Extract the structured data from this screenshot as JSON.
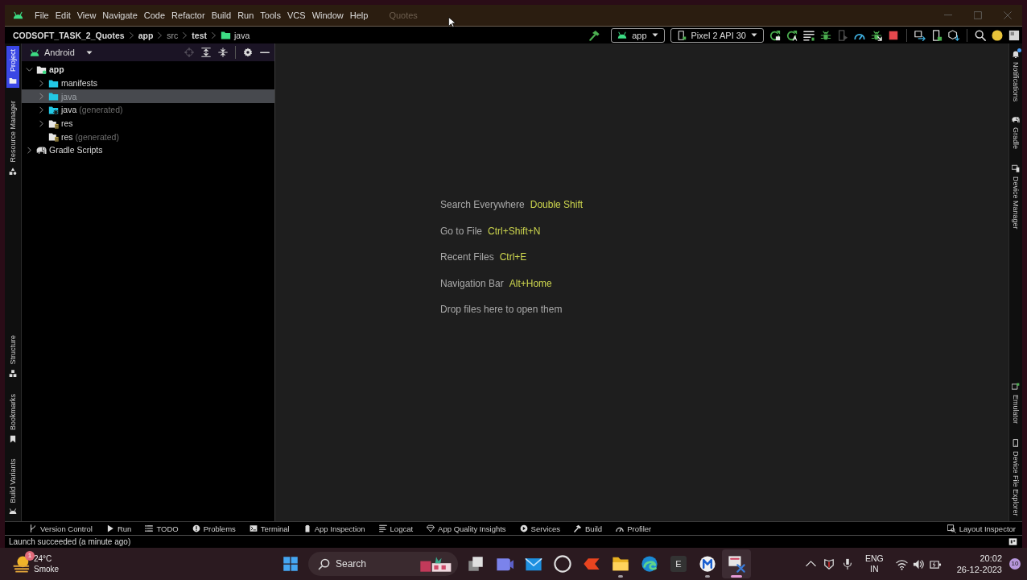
{
  "window": {
    "menu": [
      "File",
      "Edit",
      "View",
      "Navigate",
      "Code",
      "Refactor",
      "Build",
      "Run",
      "Tools",
      "VCS",
      "Window",
      "Help"
    ],
    "title": "Quotes"
  },
  "navigation_bar": {
    "breadcrumbs": [
      {
        "label": "CODSOFT_TASK_2_Quotes",
        "kind": "project"
      },
      {
        "label": "app",
        "kind": "module"
      },
      {
        "label": "src",
        "kind": "directory"
      },
      {
        "label": "test",
        "kind": "source-set"
      },
      {
        "label": "java",
        "kind": "folder"
      }
    ]
  },
  "main_toolbar": {
    "build_action": {
      "disabled": false
    },
    "run_configuration": "app",
    "device": "Pixel 2 API 30",
    "run_actions": [
      {
        "kind": "restart",
        "disabled": false
      },
      {
        "kind": "apply-code",
        "disabled": false
      },
      {
        "kind": "lines",
        "disabled": false
      },
      {
        "kind": "bug",
        "disabled": false
      },
      {
        "kind": "profile",
        "disabled": true
      },
      {
        "kind": "gauge",
        "disabled": false
      },
      {
        "kind": "attach-bug",
        "disabled": false
      },
      {
        "kind": "stop",
        "disabled": false
      }
    ],
    "tool_actions": [
      {
        "kind": "mirror"
      },
      {
        "kind": "phone"
      },
      {
        "kind": "cube"
      }
    ],
    "ide_actions": [
      {
        "kind": "search"
      },
      {
        "kind": "update"
      },
      {
        "kind": "square"
      }
    ]
  },
  "left_strip": {
    "top": [
      {
        "label": "Project",
        "kind": "folder",
        "selected": true
      },
      {
        "label": "Resource Manager",
        "kind": "shapes",
        "selected": false
      }
    ],
    "bottom": [
      {
        "label": "Structure",
        "kind": "structure",
        "selected": false
      },
      {
        "label": "Bookmarks",
        "kind": "bookmark",
        "selected": false
      },
      {
        "label": "Build Variants",
        "kind": "variants",
        "selected": false
      }
    ]
  },
  "project_panel": {
    "view": "Android",
    "header_actions": [
      {
        "kind": "locate",
        "disabled": true
      },
      {
        "kind": "expand-all",
        "disabled": false
      },
      {
        "kind": "collapse-all",
        "disabled": false
      },
      {
        "kind": "settings",
        "disabled": false
      },
      {
        "kind": "hide",
        "disabled": false
      }
    ],
    "tree": [
      {
        "label": "app",
        "kind": "module",
        "expandable": true,
        "expanded": true,
        "selected": false,
        "children": [
          {
            "label": "manifests",
            "kind": "folder",
            "expandable": true,
            "expanded": false,
            "selected": false
          },
          {
            "label": "java",
            "kind": "folder",
            "expandable": true,
            "expanded": false,
            "selected": true
          },
          {
            "label": "java",
            "note": "(generated)",
            "kind": "generated-folder",
            "expandable": true,
            "expanded": false,
            "selected": false
          },
          {
            "label": "res",
            "kind": "res-folder",
            "expandable": true,
            "expanded": false,
            "selected": false
          },
          {
            "label": "res",
            "note": "(generated)",
            "kind": "res-folder",
            "expandable": false,
            "selected": false
          }
        ]
      },
      {
        "label": "Gradle Scripts",
        "kind": "gradle",
        "expandable": true,
        "expanded": false,
        "selected": false
      }
    ]
  },
  "editor": {
    "hints": [
      {
        "action": "Search Everywhere",
        "shortcut": "Double Shift"
      },
      {
        "action": "Go to File",
        "shortcut": "Ctrl+Shift+N"
      },
      {
        "action": "Recent Files",
        "shortcut": "Ctrl+E"
      },
      {
        "action": "Navigation Bar",
        "shortcut": "Alt+Home"
      },
      {
        "action": "Drop files here to open them"
      }
    ]
  },
  "right_strip": {
    "top": [
      {
        "label": "Notifications",
        "kind": "bell",
        "unread": true
      },
      {
        "label": "Gradle",
        "kind": "elephant",
        "unread": false
      },
      {
        "label": "Device Manager",
        "kind": "devices",
        "unread": false
      }
    ],
    "bottom": [
      {
        "label": "Emulator",
        "kind": "emulator",
        "unread": false
      },
      {
        "label": "Device File Explorer",
        "kind": "phone",
        "unread": false
      }
    ]
  },
  "tool_window_bar": {
    "left": [
      {
        "label": "Version Control",
        "kind": "vcs"
      },
      {
        "label": "Run",
        "kind": "run"
      },
      {
        "label": "TODO",
        "kind": "todo"
      },
      {
        "label": "Problems",
        "kind": "problems"
      },
      {
        "label": "Terminal",
        "kind": "terminal"
      },
      {
        "label": "App Inspection",
        "kind": "inspection"
      },
      {
        "label": "Logcat",
        "kind": "logcat"
      },
      {
        "label": "App Quality Insights",
        "kind": "insights"
      },
      {
        "label": "Services",
        "kind": "services"
      },
      {
        "label": "Build",
        "kind": "build"
      },
      {
        "label": "Profiler",
        "kind": "profiler"
      }
    ],
    "right": [
      {
        "label": "Layout Inspector",
        "kind": "layout-inspector"
      }
    ]
  },
  "status_bar": {
    "message": "Launch succeeded (a minute ago)"
  },
  "taskbar": {
    "weather": {
      "temperature": "24°C",
      "condition": "Smoke",
      "badge": "1"
    },
    "search": {
      "placeholder": "Search"
    },
    "apps": [
      {
        "kind": "meet",
        "running": false,
        "selected": false
      },
      {
        "kind": "mail",
        "running": false,
        "selected": false
      },
      {
        "kind": "dell",
        "running": false,
        "selected": false
      },
      {
        "kind": "red-arrow",
        "running": false,
        "selected": false
      },
      {
        "kind": "folder",
        "running": true,
        "selected": false
      },
      {
        "kind": "edge",
        "running": false,
        "selected": false
      },
      {
        "kind": "letter-tile",
        "glyph": "E",
        "running": false,
        "selected": false
      },
      {
        "kind": "m-circle",
        "running": true,
        "selected": false
      },
      {
        "kind": "snipping",
        "running": true,
        "selected": true
      }
    ],
    "tray": {
      "language": "ENG",
      "region": "IN",
      "time": "20:02",
      "date": "26-12-2023",
      "notifications": "10"
    }
  }
}
